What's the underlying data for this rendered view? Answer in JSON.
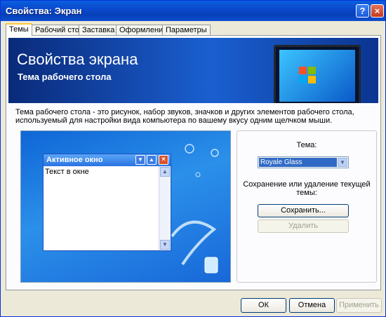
{
  "window": {
    "title": "Свойства: Экран",
    "help_icon": "?",
    "close_icon": "×"
  },
  "tabs": [
    {
      "label": "Темы",
      "active": true
    },
    {
      "label": "Рабочий стол",
      "active": false
    },
    {
      "label": "Заставка",
      "active": false
    },
    {
      "label": "Оформление",
      "active": false
    },
    {
      "label": "Параметры",
      "active": false
    }
  ],
  "banner": {
    "title": "Свойства экрана",
    "subtitle": "Тема рабочего стола"
  },
  "description": "Тема рабочего стола - это рисунок, набор звуков, значков и других элементов рабочего стола, используемый для настройки вида компьютера по вашему вкусу одним щелчком мыши.",
  "preview": {
    "window_title": "Активное окно",
    "window_text": "Текст в окне"
  },
  "theme": {
    "label": "Тема:",
    "selected": "Royale Glass",
    "save_description": "Сохранение или удаление текущей темы:",
    "save_button": "Сохранить...",
    "delete_button": "Удалить"
  },
  "footer": {
    "ok": "ОК",
    "cancel": "Отмена",
    "apply": "Применить"
  },
  "colors": {
    "titlebar": "#0a47c9",
    "accent": "#316ac5",
    "tab_highlight": "#ffc83c"
  }
}
